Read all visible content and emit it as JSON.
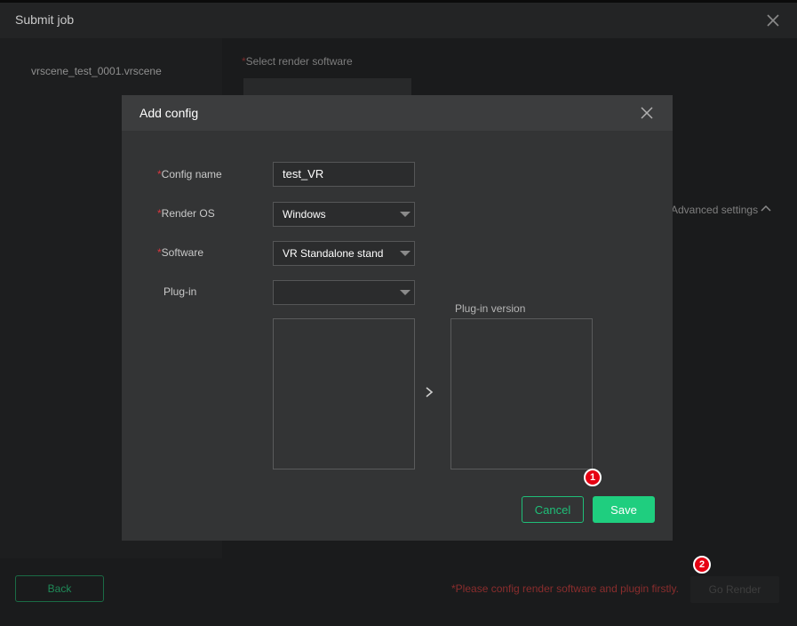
{
  "window": {
    "title": "Submit job",
    "file_item": "vrscene_test_0001.vrscene",
    "select_render_software_label": "Select render software",
    "required_mark": "*",
    "advanced_settings": "Advanced settings",
    "back_label": "Back",
    "warning": "*Please config render software and plugin firstly.",
    "go_render_label": "Go Render"
  },
  "modal": {
    "title": "Add config",
    "required_mark": "*",
    "config_name_label": "Config name",
    "config_name_value": "test_VR",
    "render_os_label": "Render OS",
    "render_os_value": "Windows",
    "software_label": "Software",
    "software_value": "VR Standalone stand",
    "plugin_label": "Plug-in",
    "plugin_value": "",
    "plugin_version_label": "Plug-in version",
    "cancel_label": "Cancel",
    "save_label": "Save"
  },
  "annotations": {
    "badge1": "1",
    "badge2": "2"
  },
  "colors": {
    "accent": "#1fce7f",
    "required": "#d9363e",
    "badge": "#e60012",
    "warning": "#8a2d2d"
  },
  "icons": {
    "window_close": "close-icon",
    "modal_close": "close-icon",
    "advanced": "chevron-up-icon",
    "transfer": "chevron-right-icon",
    "dropdown": "caret-down-icon"
  }
}
